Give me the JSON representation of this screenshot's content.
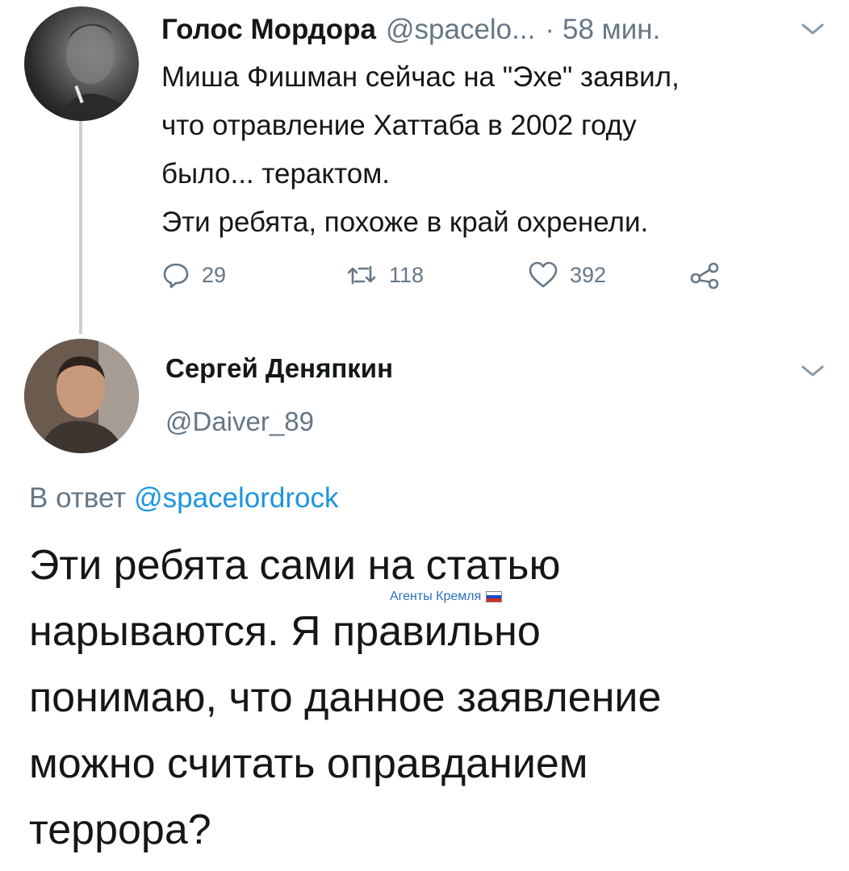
{
  "tweet1": {
    "author_name": "Голос Мордора",
    "author_handle": "@spacelo...",
    "separator": "·",
    "time": "58 мин.",
    "body_lines": [
      "Миша Фишман сейчас на \"Эхе\" заявил,",
      "что отравление Хаттаба в 2002 году",
      "было... терактом.",
      "Эти ребята, похоже в край охренели."
    ],
    "actions": {
      "replies": "29",
      "retweets": "118",
      "likes": "392"
    }
  },
  "tweet2": {
    "author_name": "Сергей Деняпкин",
    "author_handle": "@Daiver_89",
    "reply_prefix": "В ответ",
    "reply_mention": "@spacelordrock",
    "body_lines": [
      "Эти ребята сами на статью",
      "нарываются. Я правильно",
      "понимаю, что данное заявление",
      "можно считать оправданием",
      "террора?"
    ]
  },
  "watermark": {
    "text": "Агенты Кремля"
  },
  "colors": {
    "text": "#14171a",
    "muted": "#657786",
    "link": "#1b95e0",
    "thread_line": "#c8d1d9"
  },
  "icons": [
    "reply-icon",
    "retweet-icon",
    "like-icon",
    "share-icon",
    "chevron-down-icon",
    "russia-flag-icon"
  ]
}
